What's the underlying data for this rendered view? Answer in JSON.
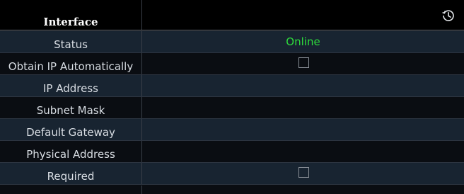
{
  "header": {
    "title": "Interface",
    "history_icon": "history-icon"
  },
  "rows": [
    {
      "label": "Status",
      "value": "Online",
      "value_color": "#2edc3c"
    },
    {
      "label": "Obtain IP Automatically",
      "checked": false
    },
    {
      "label": "IP Address",
      "value": ""
    },
    {
      "label": "Subnet Mask",
      "value": ""
    },
    {
      "label": "Default Gateway",
      "value": ""
    },
    {
      "label": "Physical Address",
      "value": ""
    },
    {
      "label": "Required",
      "checked": false
    }
  ]
}
